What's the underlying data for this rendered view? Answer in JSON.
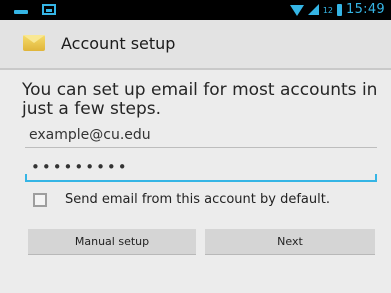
{
  "status_bar": {
    "network_label": "12",
    "time": "15:49",
    "accent_color": "#35b5e5"
  },
  "action_bar": {
    "icon": "email-envelope-icon",
    "title": "Account setup"
  },
  "content": {
    "intro": "You can set up email for most accounts in just a few steps.",
    "email": {
      "value": "example@cu.edu"
    },
    "password": {
      "masked_value": "•••••••••"
    },
    "default_checkbox": {
      "label": "Send email from this account by default.",
      "checked": false
    }
  },
  "buttons": {
    "manual_setup": "Manual setup",
    "next": "Next"
  }
}
